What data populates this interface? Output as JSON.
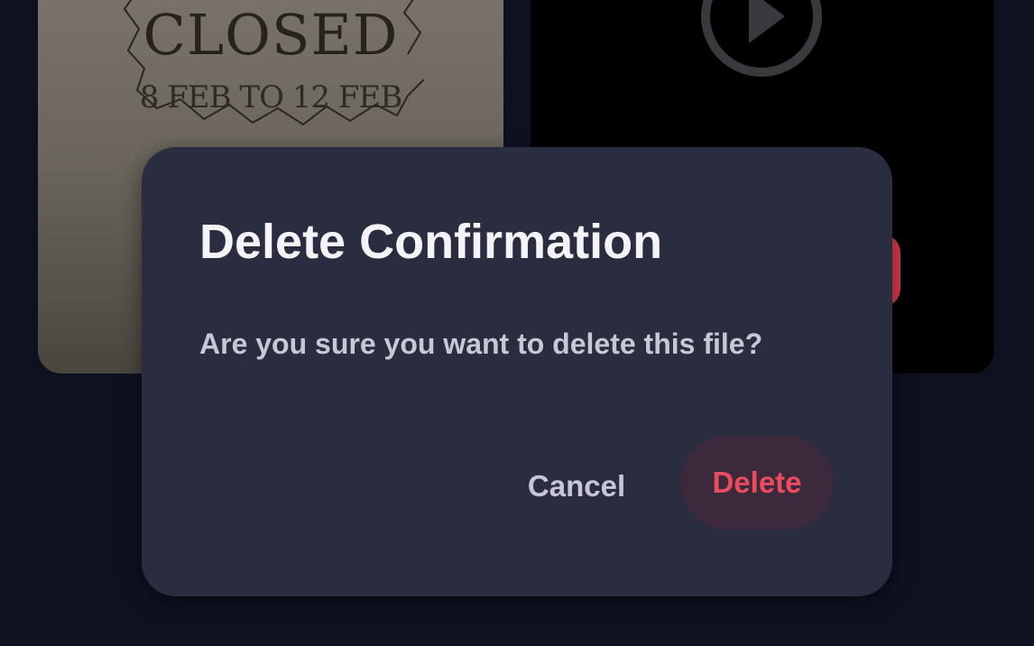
{
  "background_cards": {
    "left_card": {
      "notice_title": "CLOSED",
      "notice_dates": "8 FEB TO 12 FEB"
    },
    "right_card": {
      "icon": "play-icon"
    }
  },
  "dialog": {
    "title": "Delete Confirmation",
    "message": "Are you sure you want to delete this file?",
    "cancel_label": "Cancel",
    "delete_label": "Delete"
  },
  "colors": {
    "dialog_background": "#2a2c40",
    "delete_accent": "#ea4b5e",
    "page_background": "#0e1220"
  }
}
